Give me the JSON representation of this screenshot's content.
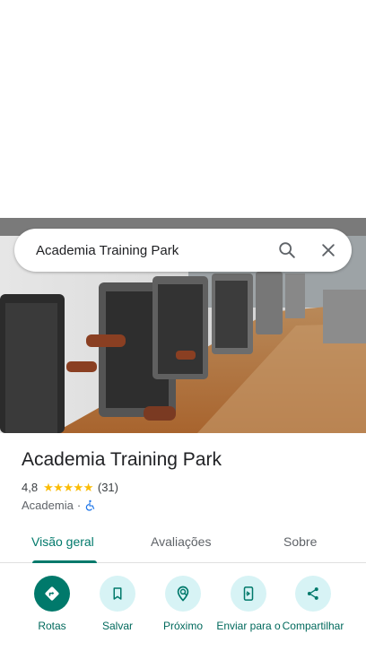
{
  "search": {
    "query": "Academia Training Park"
  },
  "place": {
    "name": "Academia Training Park",
    "rating": "4,8",
    "stars": "★★★★★",
    "review_count": "(31)",
    "category": "Academia",
    "separator": "·"
  },
  "tabs": [
    {
      "label": "Visão geral",
      "active": true
    },
    {
      "label": "Avaliações",
      "active": false
    },
    {
      "label": "Sobre",
      "active": false
    }
  ],
  "actions": [
    {
      "label": "Rotas",
      "icon": "directions-icon"
    },
    {
      "label": "Salvar",
      "icon": "bookmark-icon"
    },
    {
      "label": "Próximo",
      "icon": "nearby-icon"
    },
    {
      "label": "Enviar para o",
      "icon": "send-to-phone-icon"
    },
    {
      "label": "Compartilhar",
      "icon": "share-icon"
    }
  ],
  "colors": {
    "accent": "#00796b",
    "action_bg": "#d7f3f5",
    "star": "#fbbc04"
  }
}
